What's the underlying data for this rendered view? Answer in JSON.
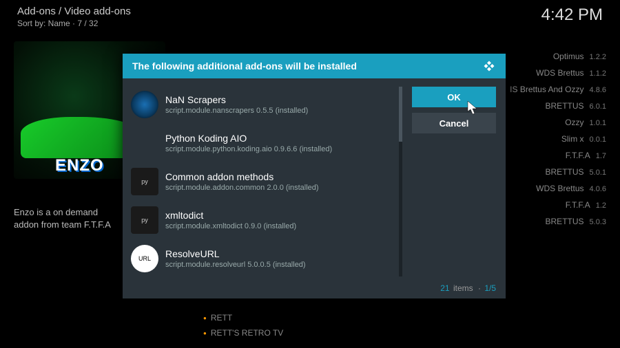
{
  "header": {
    "breadcrumb": "Add-ons / Video add-ons",
    "sort_label": "Sort by: Name",
    "position": "7 / 32",
    "clock": "4:42 PM"
  },
  "background": {
    "poster_title": "ENZO",
    "description": "Enzo is a on demand addon from team F.T.F.A",
    "addons": [
      {
        "name": "Optimus",
        "version": "1.2.2"
      },
      {
        "name": "WDS Brettus",
        "version": "1.1.2"
      },
      {
        "name": "IS Brettus And Ozzy",
        "version": "4.8.6"
      },
      {
        "name": "BRETTUS",
        "version": "6.0.1"
      },
      {
        "name": "Ozzy",
        "version": "1.0.1"
      },
      {
        "name": "Slim x",
        "version": "0.0.1"
      },
      {
        "name": "F.T.F.A",
        "version": "1.7"
      },
      {
        "name": "BRETTUS",
        "version": "5.0.1"
      },
      {
        "name": "WDS Brettus",
        "version": "4.0.6"
      },
      {
        "name": "F.T.F.A",
        "version": "1.2"
      },
      {
        "name": "BRETTUS",
        "version": "5.0.3"
      }
    ],
    "bottom_items": [
      "RETT",
      "RETT'S RETRO TV"
    ]
  },
  "dialog": {
    "title": "The following additional add-ons will be installed",
    "items": [
      {
        "name": "NaN Scrapers",
        "detail": "script.module.nanscrapers 0.5.5 (installed)",
        "icon": "round"
      },
      {
        "name": "Python Koding AIO",
        "detail": "script.module.python.koding.aio 0.9.6.6 (installed)",
        "icon": "none"
      },
      {
        "name": "Common addon methods",
        "detail": "script.module.addon.common 2.0.0 (installed)",
        "icon": "python"
      },
      {
        "name": "xmltodict",
        "detail": "script.module.xmltodict 0.9.0 (installed)",
        "icon": "python"
      },
      {
        "name": "ResolveURL",
        "detail": "script.module.resolveurl 5.0.0.5 (installed)",
        "icon": "white"
      }
    ],
    "ok_label": "OK",
    "cancel_label": "Cancel",
    "count": "21",
    "items_label": "items",
    "separator": "·",
    "page": "1/5"
  }
}
